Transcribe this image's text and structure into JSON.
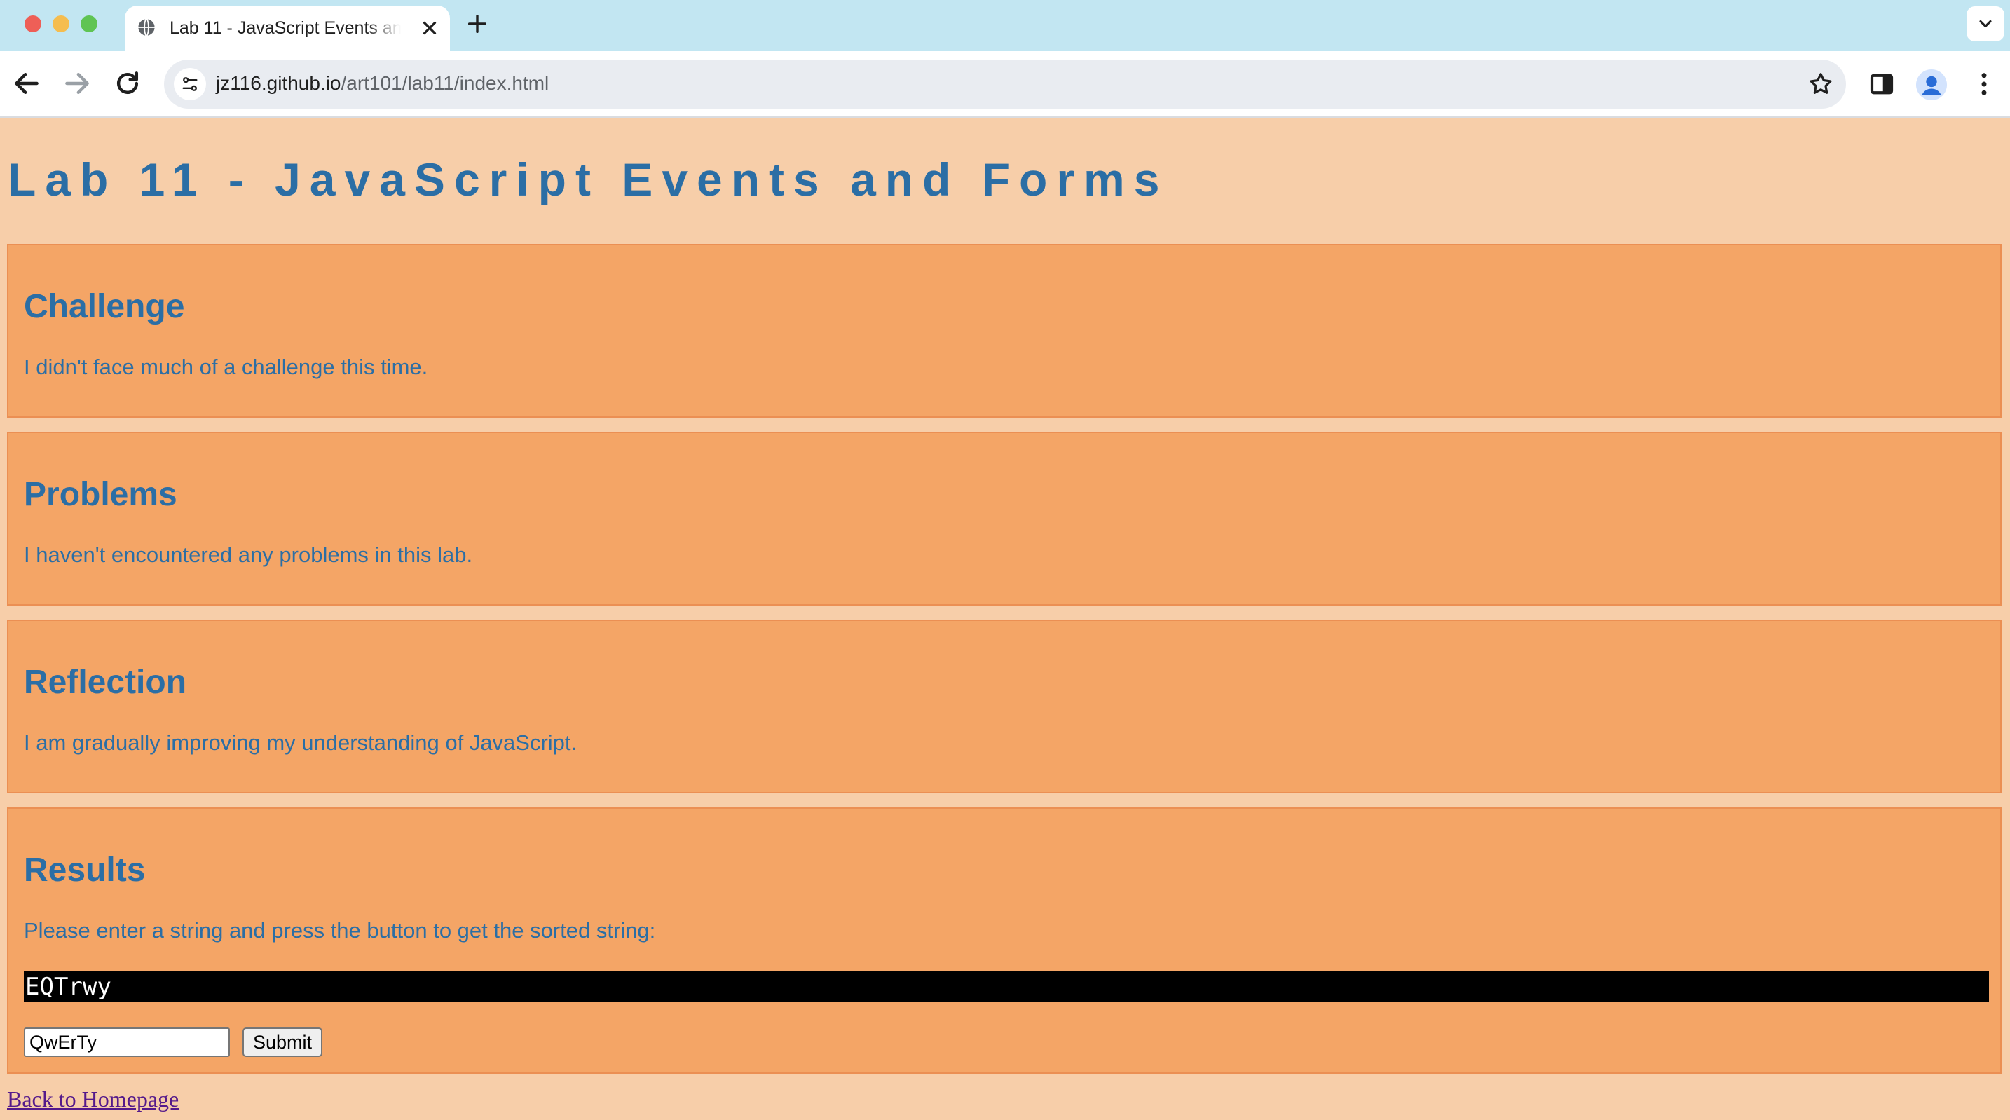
{
  "browser": {
    "tab": {
      "title": "Lab 11 - JavaScript Events and Forms"
    },
    "address": {
      "host": "jz116.github.io",
      "path": "/art101/lab11/index.html"
    }
  },
  "page": {
    "title": "Lab 11 - JavaScript Events and Forms",
    "sections": {
      "challenge": {
        "heading": "Challenge",
        "text": "I didn't face much of a challenge this time."
      },
      "problems": {
        "heading": "Problems",
        "text": "I haven't encountered any problems in this lab."
      },
      "reflection": {
        "heading": "Reflection",
        "text": "I am gradually improving my understanding of JavaScript."
      },
      "results": {
        "heading": "Results",
        "instructions": "Please enter a string and press the button to get the sorted string:",
        "output": "EQTrwy",
        "input_value": "QwErTy",
        "submit_label": "Submit"
      }
    },
    "back_link": "Back to Homepage"
  },
  "colors": {
    "page_background": "#f7cea9",
    "section_background": "#f4a566",
    "text_blue": "#2b6ea5",
    "output_background": "#000000",
    "tabbar": "#c2e6f2"
  },
  "icons": [
    "globe-icon",
    "close-icon",
    "plus-icon",
    "chevron-down-icon",
    "back-arrow-icon",
    "forward-arrow-icon",
    "reload-icon",
    "site-settings-icon",
    "star-icon",
    "side-panel-icon",
    "profile-icon",
    "more-vertical-icon"
  ]
}
